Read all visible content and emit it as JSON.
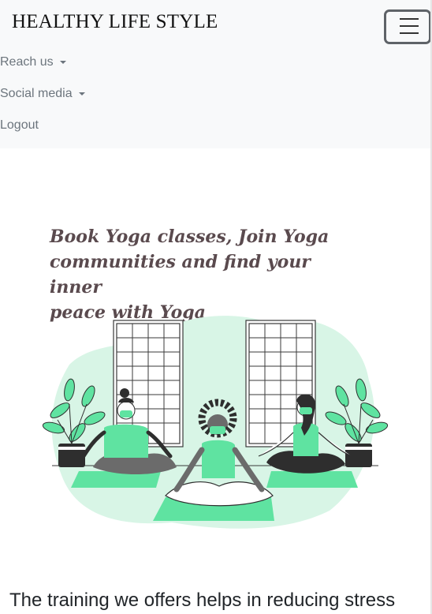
{
  "navbar": {
    "brand": "HEALTHY LIFE STYLE",
    "items": [
      {
        "label": "Reach us",
        "dropdown": true
      },
      {
        "label": "Social media",
        "dropdown": true
      },
      {
        "label": "Logout",
        "dropdown": false
      }
    ]
  },
  "hero": {
    "headline_lines": [
      "Book Yoga classes, Join Yoga",
      "communities and find your inner",
      "peace with Yoga"
    ],
    "illustration": "yoga-class-illustration"
  },
  "content": {
    "paragraph": "The training we offers helps in reducing stress"
  },
  "colors": {
    "accent_green": "#5fe3a1",
    "blob": "#d8f5e6",
    "navbar_bg": "#f8f9fa",
    "nav_text": "#6c757d"
  }
}
